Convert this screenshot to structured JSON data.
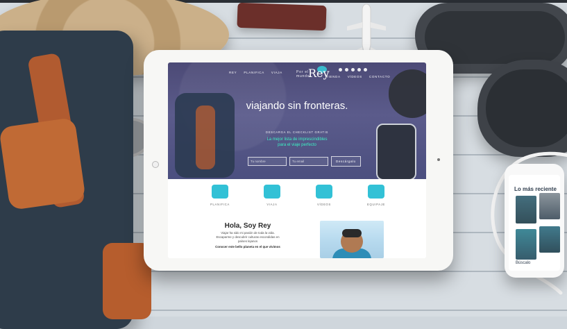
{
  "tablet_site": {
    "nav_left": [
      "Rey",
      "Planifica",
      "Viaja"
    ],
    "nav_right": [
      "Tienda",
      "Vídeos",
      "Contacto"
    ],
    "logo": {
      "small_text": "Por el mundo",
      "mark": "Rey"
    },
    "hero": {
      "title": "viajando sin fronteras.",
      "kicker": "DESCARGA EL CHECKLIST GRATIS",
      "subtitle_lines": [
        "La mejor lista de imprescindibles",
        "para el viaje perfecto"
      ],
      "name_placeholder": "Tu nombre",
      "email_placeholder": "Tu email",
      "cta": "Descárgalo"
    },
    "categories": [
      {
        "label": "PLANIFICA",
        "icon": "ticket-icon"
      },
      {
        "label": "VIAJA",
        "icon": "map-icon"
      },
      {
        "label": "VÍDEOS",
        "icon": "camera-icon"
      },
      {
        "label": "EQUIPAJE",
        "icon": "suitcase-icon"
      }
    ],
    "about": {
      "title": "Hola, Soy Rey",
      "text_lines": [
        "Viajar ha sido mi pasión de toda la vida.",
        "Escaparme y descubrir culturas escondidas en",
        "países lejanos"
      ],
      "strong": "Conocer este bello planeta en el que vivimos"
    }
  },
  "phone": {
    "title": "Lo más reciente",
    "search_label": "Búscalo"
  },
  "colors": {
    "accent_teal": "#32c1d6",
    "hero_purple": "#4c4a76",
    "hero_accent_green": "#3cf2c4"
  }
}
